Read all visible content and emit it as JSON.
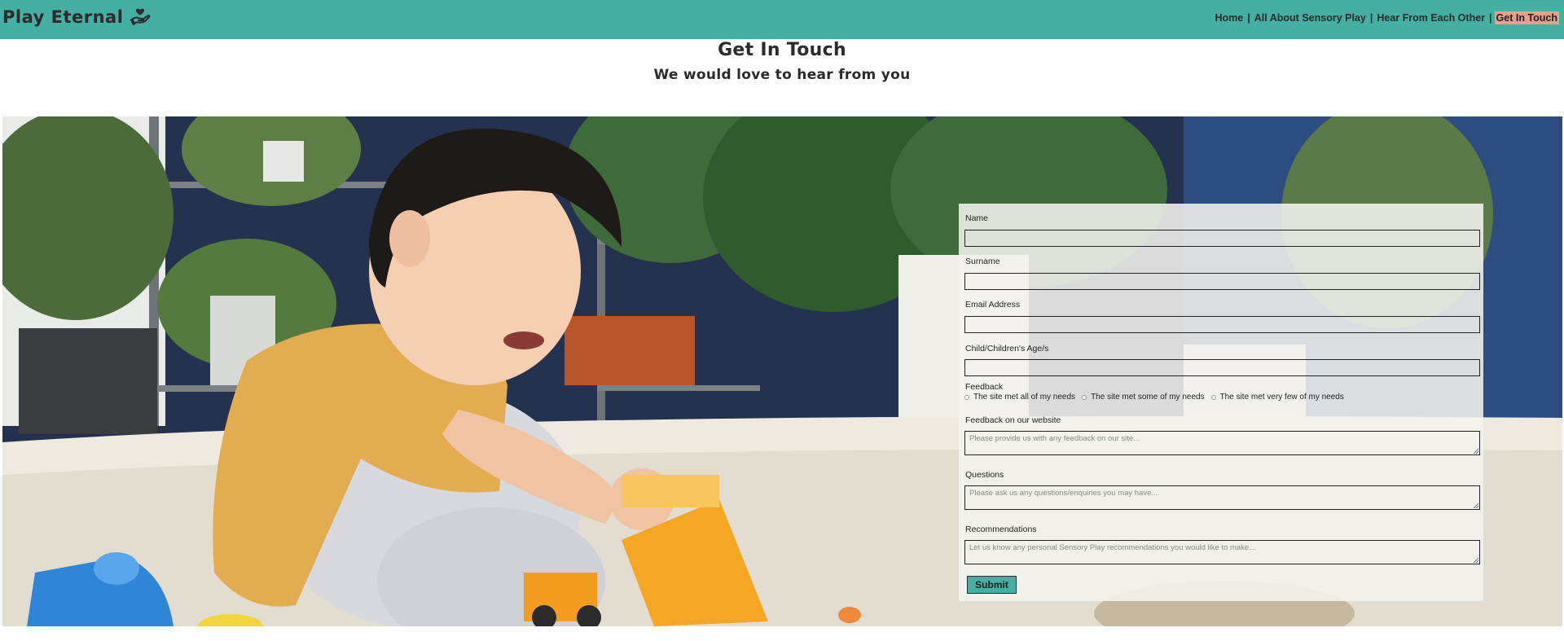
{
  "brand": {
    "name": "Play Eternal",
    "icon": "hand-heart-icon"
  },
  "nav": {
    "items": [
      {
        "label": "Home"
      },
      {
        "label": "All About Sensory Play"
      },
      {
        "label": "Hear From Each Other"
      },
      {
        "label": "Get In Touch"
      }
    ],
    "separator": "|",
    "active": "Get In Touch"
  },
  "heading": {
    "title": "Get In Touch",
    "subtitle": "We would love to hear from you"
  },
  "form": {
    "name_label": "Name",
    "surname_label": "Surname",
    "email_label": "Email Address",
    "age_label": "Child/Children's Age/s",
    "feedback_label": "Feedback",
    "feedback_options": [
      "The site met all of my needs",
      "The site met some of my needs",
      "The site met very few of my needs"
    ],
    "website_feedback_label": "Feedback on our website",
    "website_feedback_placeholder": "Please provide us with any feedback on our site...",
    "questions_label": "Questions",
    "questions_placeholder": "Please ask us any questions/enquiries you may have...",
    "recommendations_label": "Recommendations",
    "recommendations_placeholder": "Let us know any personal Sensory Play recommendations you would like to make...",
    "submit_label": "Submit"
  },
  "colors": {
    "header": "#44afa2",
    "active_nav": "#e7a08b",
    "submit": "#44afa2"
  }
}
